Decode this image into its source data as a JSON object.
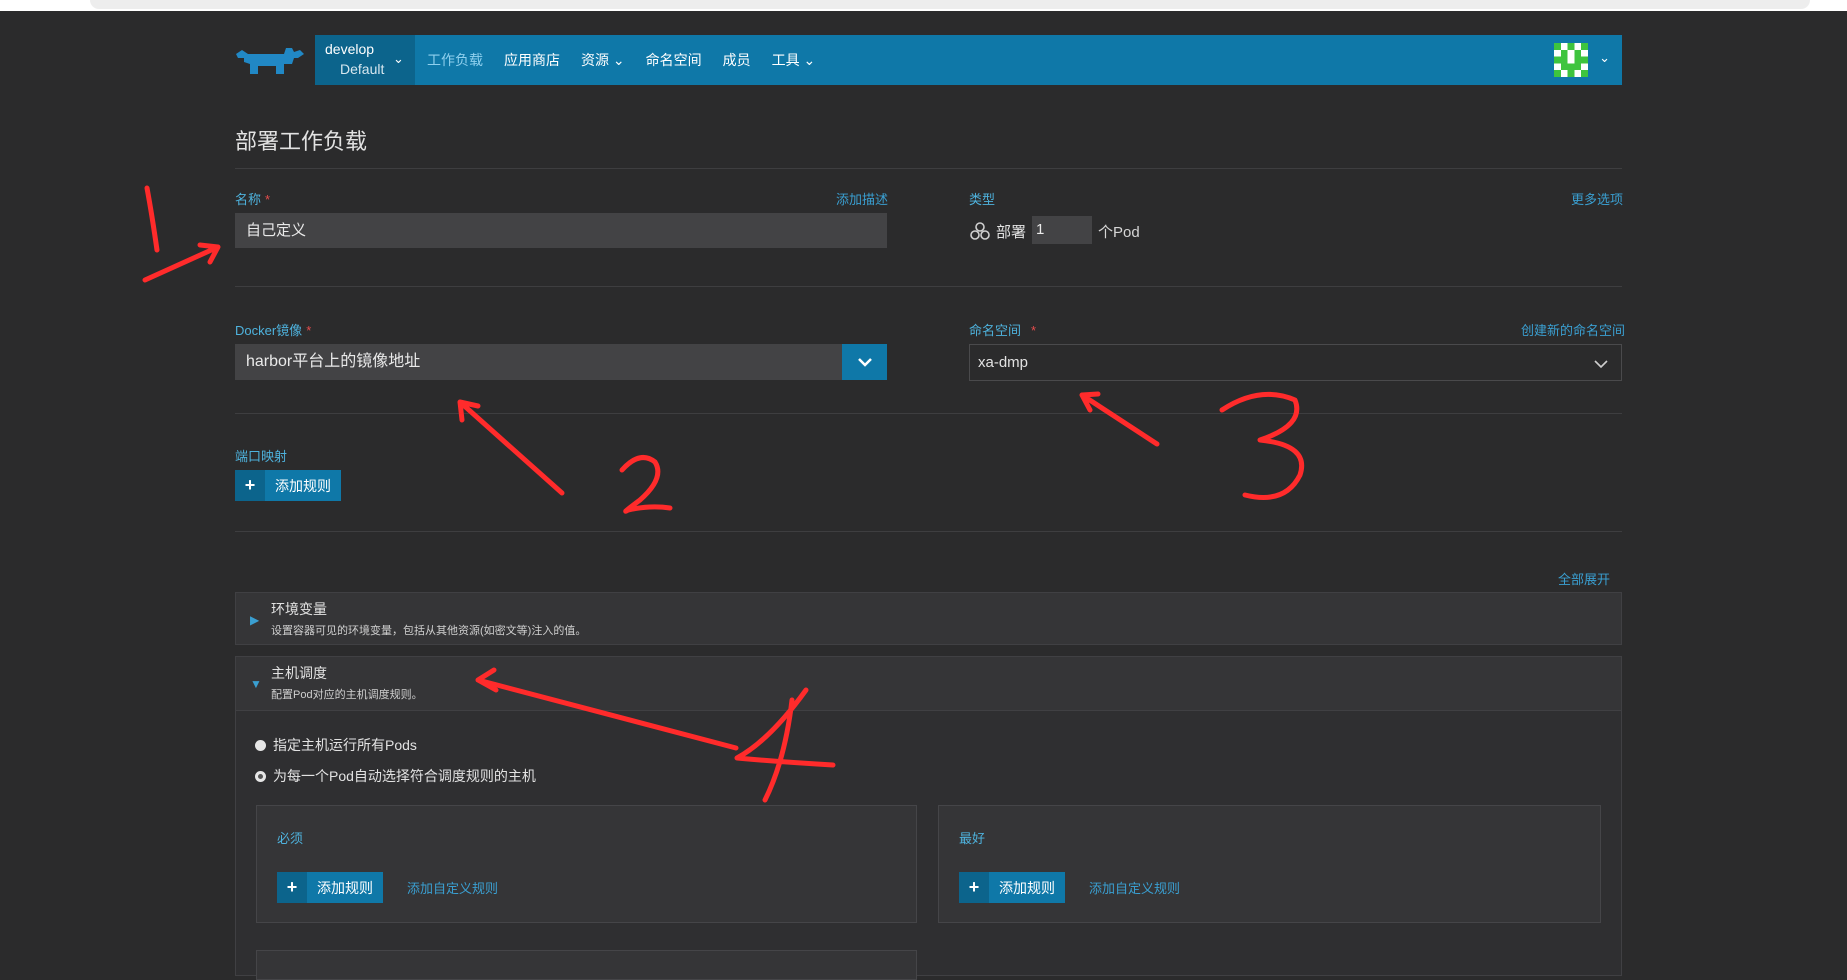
{
  "header": {
    "environment": {
      "name": "develop",
      "project": "Default"
    },
    "nav": [
      "工作负载",
      "应用商店",
      "资源",
      "命名空间",
      "成员",
      "工具"
    ],
    "active_nav": 0
  },
  "page": {
    "title": "部署工作负载"
  },
  "form": {
    "name": {
      "label": "名称",
      "value": "自己定义",
      "add_desc_link": "添加描述"
    },
    "type": {
      "label": "类型",
      "more_options_link": "更多选项",
      "kind": "部署",
      "count": "1",
      "unit": "个Pod"
    },
    "image": {
      "label": "Docker镜像",
      "value": "harbor平台上的镜像地址"
    },
    "namespace": {
      "label": "命名空间",
      "value": "xa-dmp",
      "create_link": "创建新的命名空间"
    },
    "ports": {
      "label": "端口映射",
      "add_rule": "添加规则"
    }
  },
  "sections": {
    "expand_all": "全部展开",
    "env": {
      "title": "环境变量",
      "desc": "设置容器可见的环境变量，包括从其他资源(如密文等)注入的值。"
    },
    "scheduling": {
      "title": "主机调度",
      "desc": "配置Pod对应的主机调度规则。",
      "options": [
        "指定主机运行所有Pods",
        "为每一个Pod自动选择符合调度规则的主机"
      ],
      "selected": 1,
      "required": {
        "title": "必须",
        "add_rule": "添加规则",
        "custom_link": "添加自定义规则"
      },
      "preferred": {
        "title": "最好",
        "add_rule": "添加规则",
        "custom_link": "添加自定义规则"
      }
    }
  },
  "annotations": [
    "1",
    "2",
    "3",
    "4"
  ],
  "colors": {
    "header": "#0f78a8",
    "accent_text": "#4eb2dd",
    "annotation": "#ff2b2b",
    "background": "#2b2b2c"
  }
}
